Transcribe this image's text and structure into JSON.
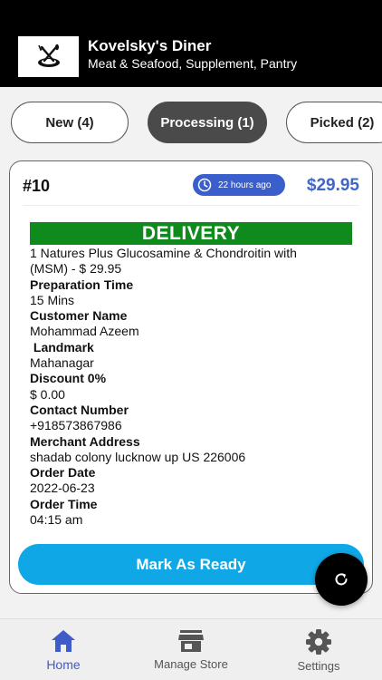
{
  "store": {
    "name": "Kovelsky's Diner",
    "categories": "Meat & Seafood, Supplement, Pantry",
    "logo_icon": "fork-knife-plate-icon"
  },
  "tabs": [
    {
      "label": "New (4)",
      "active": false
    },
    {
      "label": "Processing (1)",
      "active": true
    },
    {
      "label": "Picked (2)",
      "active": false
    }
  ],
  "order": {
    "number": "#10",
    "time_ago": "22 hours ago",
    "price": "$29.95",
    "type_banner": "DELIVERY",
    "item": "1 Natures Plus Glucosamine & Chondroitin with (MSM) - $ 29.95",
    "fields": [
      {
        "label": "Preparation Time",
        "value": "15 Mins"
      },
      {
        "label": "Customer Name",
        "value": "Mohammad Azeem"
      },
      {
        "label": " Landmark",
        "value": "Mahanagar"
      },
      {
        "label": "Discount 0%",
        "value": "$ 0.00"
      },
      {
        "label": "Contact Number",
        "value": "+918573867986"
      },
      {
        "label": "Merchant Address",
        "value": "shadab colony lucknow up US 226006"
      },
      {
        "label": "Order Date",
        "value": "2022-06-23"
      },
      {
        "label": "Order Time",
        "value": "04:15 am"
      }
    ],
    "action_label": "Mark As Ready"
  },
  "nav": [
    {
      "label": "Home",
      "icon": "home-icon",
      "active": true
    },
    {
      "label": "Manage Store",
      "icon": "store-icon",
      "active": false
    },
    {
      "label": "Settings",
      "icon": "gear-icon",
      "active": false
    }
  ],
  "colors": {
    "header_bg": "#000000",
    "accent_blue": "#3f66c9",
    "delivery_green": "#0f8a1c",
    "action_blue": "#0fa7e6"
  }
}
